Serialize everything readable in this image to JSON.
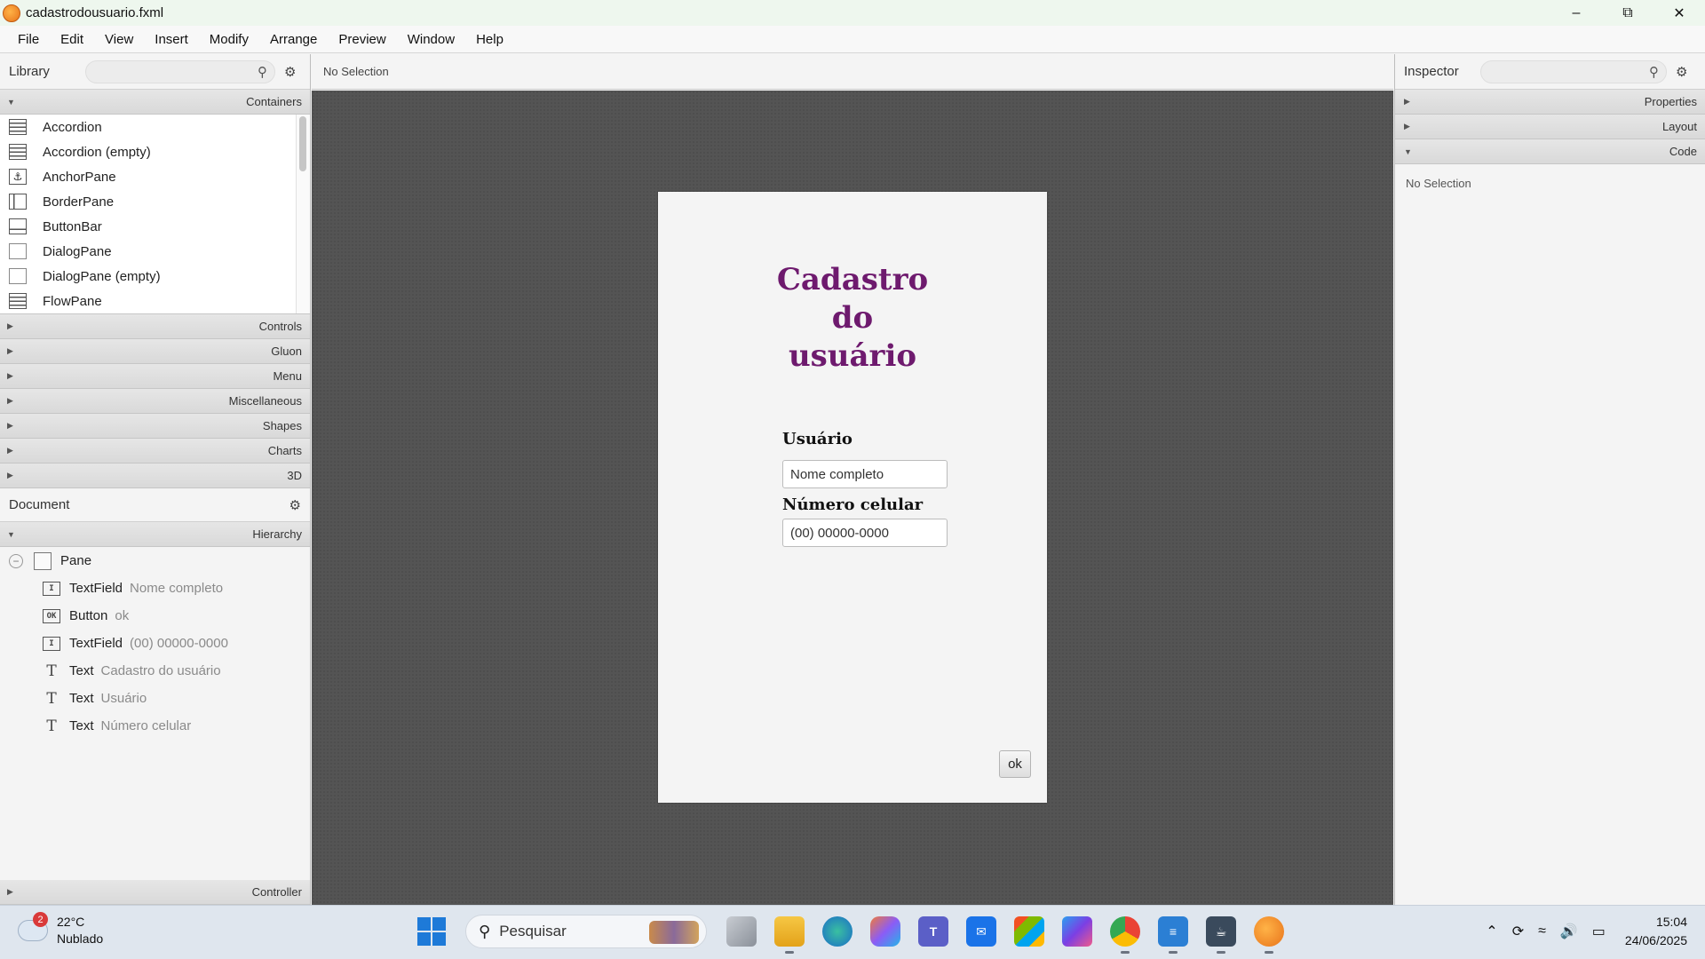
{
  "window": {
    "title": "cadastrodousuario.fxml"
  },
  "menu": [
    "File",
    "Edit",
    "View",
    "Insert",
    "Modify",
    "Arrange",
    "Preview",
    "Window",
    "Help"
  ],
  "library": {
    "title": "Library",
    "sections_open": "Containers",
    "items": [
      "Accordion",
      "Accordion  (empty)",
      "AnchorPane",
      "BorderPane",
      "ButtonBar",
      "DialogPane",
      "DialogPane  (empty)",
      "FlowPane"
    ],
    "sections_closed": [
      "Controls",
      "Gluon",
      "Menu",
      "Miscellaneous",
      "Shapes",
      "Charts",
      "3D"
    ]
  },
  "document": {
    "title": "Document",
    "hierarchy_label": "Hierarchy",
    "root": "Pane",
    "nodes": [
      {
        "type": "TextField",
        "value": "Nome completo"
      },
      {
        "type": "Button",
        "value": "ok"
      },
      {
        "type": "TextField",
        "value": "(00) 00000-0000"
      },
      {
        "type": "Text",
        "value": "Cadastro do usuário"
      },
      {
        "type": "Text",
        "value": "Usuário"
      },
      {
        "type": "Text",
        "value": "Número  celular"
      }
    ],
    "controller_label": "Controller"
  },
  "center": {
    "selection_status": "No Selection"
  },
  "form": {
    "title_lines": [
      "Cadastro",
      "do",
      "usuário"
    ],
    "user_label": "Usuário",
    "user_placeholder": "Nome completo",
    "phone_label": "Número  celular",
    "phone_placeholder": "(00) 00000-0000",
    "ok_label": "ok",
    "title_color": "#6e1a6e"
  },
  "inspector": {
    "title": "Inspector",
    "sections": [
      "Properties",
      "Layout",
      "Code"
    ],
    "status": "No Selection"
  },
  "taskbar": {
    "weather_badge": "2",
    "temperature": "22°C",
    "condition": "Nublado",
    "search_placeholder": "Pesquisar",
    "time": "15:04",
    "date": "24/06/2025"
  }
}
